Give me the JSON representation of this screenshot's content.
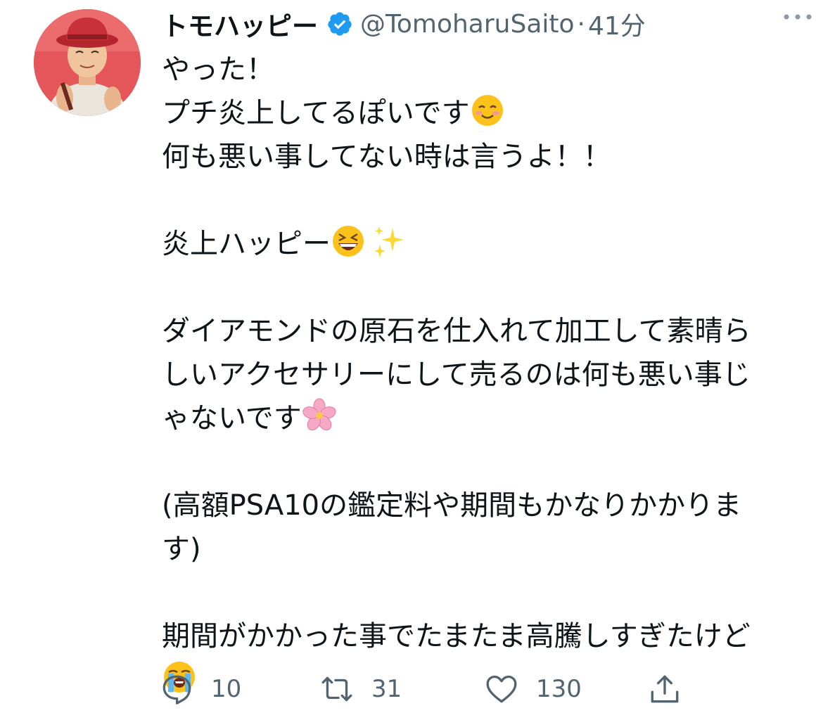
{
  "tweet": {
    "author": {
      "display_name": "トモハッピー",
      "handle": "@TomoharuSaito",
      "separator": "·",
      "timestamp": "41分",
      "verified_icon": "verified-badge-icon",
      "avatar_icon": "profile-photo"
    },
    "more_icon": "more-options-icon",
    "lines": {
      "l1": "やった！",
      "l2": "プチ炎上してるぽいです",
      "l3": "何も悪い事してない時は言うよ！！",
      "l4": "炎上ハッピー",
      "l5": "ダイアモンドの原石を仕入れて加工して素晴ら",
      "l6": "しいアクセサリーにして売るのは何も悪い事じ",
      "l7": "ゃないです",
      "l8": "(高額PSA10の鑑定料や期間もかなりかかりま",
      "l9": "す)",
      "l10": "期間がかかった事でたまたま高騰しすぎたけど"
    },
    "emojis": {
      "smiling": "smiling-face-icon",
      "grinning_squint": "grinning-squinting-face-icon",
      "sparkles": "sparkles-icon",
      "blossom": "cherry-blossom-icon",
      "crying": "loudly-crying-face-icon"
    },
    "actions": {
      "reply": {
        "count": "10",
        "icon": "reply-icon"
      },
      "retweet": {
        "count": "31",
        "icon": "retweet-icon"
      },
      "like": {
        "count": "130",
        "icon": "like-heart-icon"
      },
      "share": {
        "icon": "share-icon"
      }
    },
    "colors": {
      "text": "#0f1419",
      "secondary": "#536471",
      "verified": "#1d9bf0"
    }
  }
}
